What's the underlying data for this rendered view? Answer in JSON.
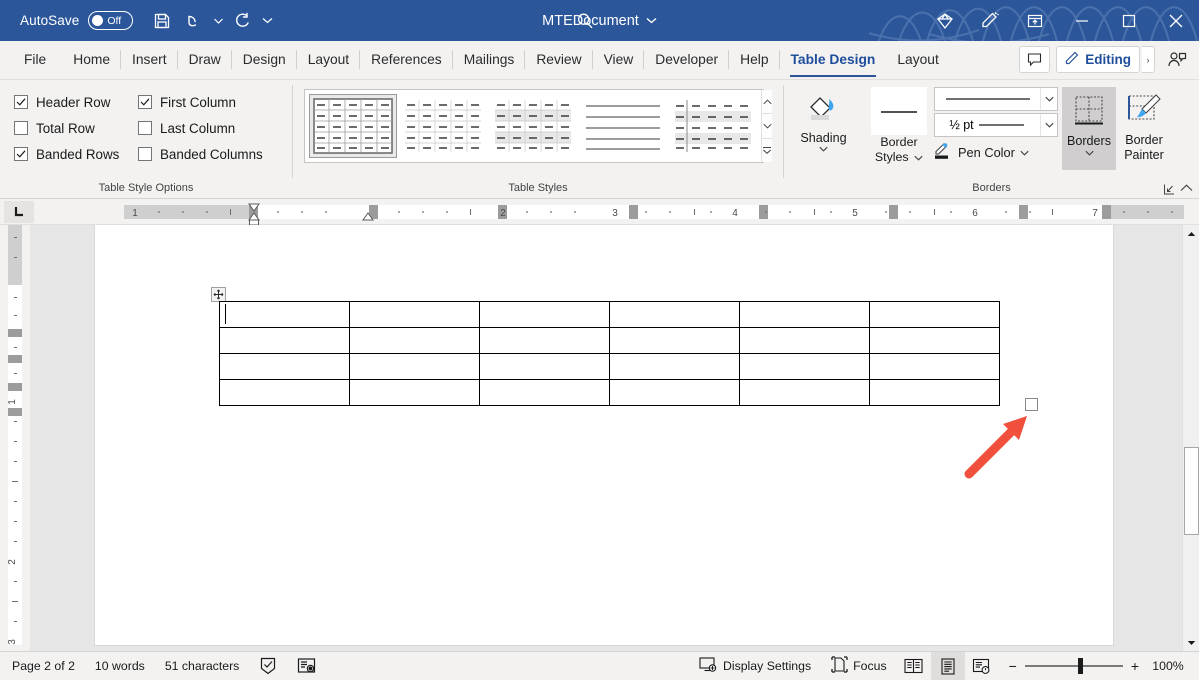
{
  "titlebar": {
    "autosave_label": "AutoSave",
    "autosave_state": "Off",
    "document_title": "MTEDocument",
    "icons": {
      "save": "save-icon",
      "undo": "undo-icon",
      "redo": "redo-icon",
      "qat_more": "quick-access-more-icon",
      "search": "search-icon",
      "diamond": "diamond-icon",
      "pen": "pen-highlighter-icon",
      "restore_ribbon": "restore-window-icon",
      "minimize": "minimize-icon",
      "maximize": "maximize-icon",
      "close": "close-icon"
    }
  },
  "tabs": [
    {
      "label": "File",
      "active": false
    },
    {
      "label": "Home",
      "active": false
    },
    {
      "label": "Insert",
      "active": false
    },
    {
      "label": "Draw",
      "active": false
    },
    {
      "label": "Design",
      "active": false
    },
    {
      "label": "Layout",
      "active": false
    },
    {
      "label": "References",
      "active": false
    },
    {
      "label": "Mailings",
      "active": false
    },
    {
      "label": "Review",
      "active": false
    },
    {
      "label": "View",
      "active": false
    },
    {
      "label": "Developer",
      "active": false
    },
    {
      "label": "Help",
      "active": false
    },
    {
      "label": "Table Design",
      "active": true
    },
    {
      "label": "Layout",
      "active": false
    }
  ],
  "tabbar_right": {
    "comments_icon": "comment-icon",
    "editing_label": "Editing",
    "editing_icon": "pencil-icon",
    "editing_caret": "›",
    "share_icon": "share-person-icon"
  },
  "ribbon": {
    "table_style_options": {
      "group_label": "Table Style Options",
      "checkboxes": [
        {
          "label": "Header Row",
          "checked": true
        },
        {
          "label": "First Column",
          "checked": true
        },
        {
          "label": "Total Row",
          "checked": false
        },
        {
          "label": "Last Column",
          "checked": false
        },
        {
          "label": "Banded Rows",
          "checked": true
        },
        {
          "label": "Banded Columns",
          "checked": false
        }
      ]
    },
    "table_styles": {
      "group_label": "Table Styles",
      "selected_index": 0,
      "thumbnails": [
        "grid-table-all-borders",
        "plain-table-dashed",
        "plain-table-banded",
        "lined-table-no-verticals",
        "lined-table-first-column"
      ],
      "scroll_up": "scroll-up-icon",
      "scroll_down": "scroll-down-icon",
      "more_styles": "more-styles-icon"
    },
    "borders": {
      "group_label": "Borders",
      "shading_label": "Shading",
      "border_styles_label": "Border Styles",
      "line_style_value": "",
      "line_weight_value": "½ pt",
      "pen_color_label": "Pen Color",
      "borders_label": "Borders",
      "borders_active": true,
      "border_painter_label": "Border Painter",
      "dialog_launcher": "dialog-launcher-icon",
      "collapse_ribbon": "collapse-ribbon-icon"
    }
  },
  "ruler": {
    "tab_stop_marker": "left-tab-stop",
    "horizontal_ticks": [
      "1",
      "2",
      "3",
      "4",
      "5",
      "6",
      "7"
    ],
    "vertical_ticks": [
      "1",
      "2",
      "3"
    ]
  },
  "document": {
    "table": {
      "rows": 4,
      "columns": 6,
      "move_handle": "table-move-handle",
      "resize_handle": "table-resize-handle"
    },
    "annotation": {
      "type": "red-arrow",
      "points_at": "table-resize-handle"
    }
  },
  "statusbar": {
    "page_info": "Page 2 of 2",
    "word_count": "10 words",
    "char_count": "51 characters",
    "proofing_icon": "spelling-check-icon",
    "accessibility_icon": "accessibility-icon",
    "display_settings": "Display Settings",
    "focus": "Focus",
    "views": [
      {
        "name": "read-mode-view",
        "active": false
      },
      {
        "name": "print-layout-view",
        "active": true
      },
      {
        "name": "web-layout-view",
        "active": false
      }
    ],
    "zoom_out": "−",
    "zoom_in": "+",
    "zoom_level": "100%"
  },
  "colors": {
    "titlebar": "#2b579a",
    "ribbon_bg": "#f3f2f1",
    "accent": "#1f4e9c",
    "annotation_red": "#f0503c",
    "canvas_bg": "#e6e6e6"
  }
}
